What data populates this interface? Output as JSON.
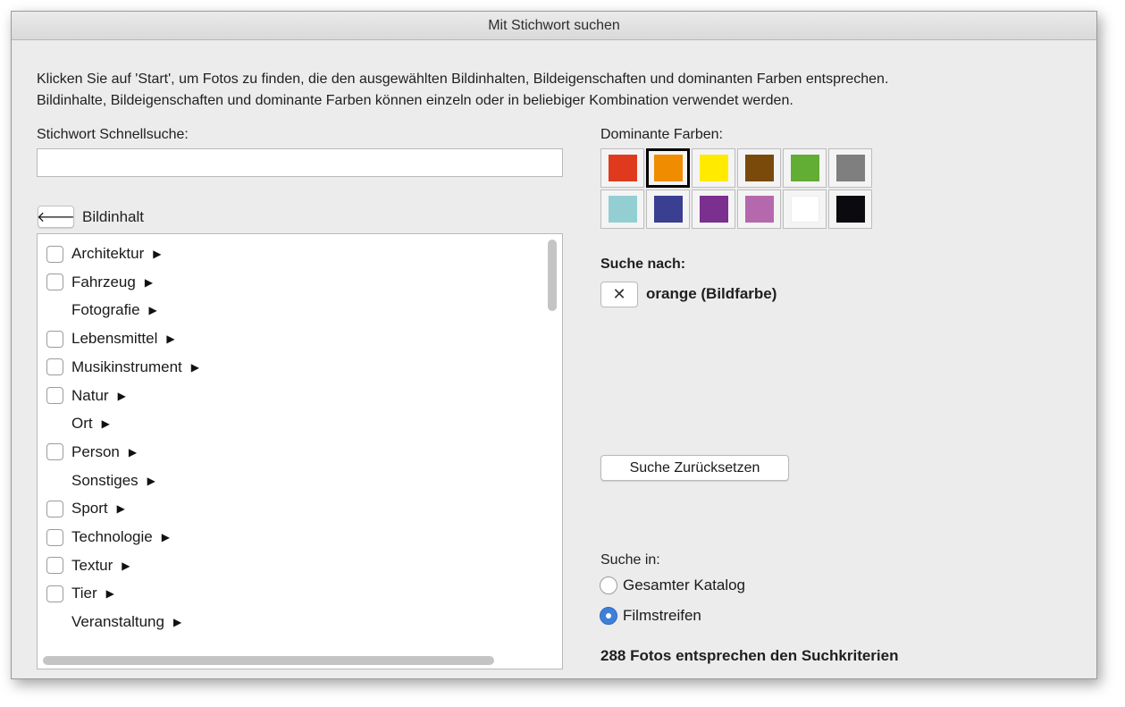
{
  "window": {
    "title": "Mit Stichwort suchen"
  },
  "intro": {
    "line1": "Klicken Sie auf 'Start', um Fotos zu finden, die den ausgewählten Bildinhalten, Bildeigenschaften und dominanten Farben entsprechen.",
    "line2": "Bildinhalte, Bildeigenschaften und dominante Farben können einzeln oder in beliebiger Kombination verwendet werden."
  },
  "quick_search": {
    "label": "Stichwort Schnellsuche:",
    "value": "",
    "placeholder": ""
  },
  "content_list": {
    "back_icon": "arrow-left-icon",
    "back_glyph": "🡐",
    "heading": "Bildinhalt",
    "items": [
      {
        "label": "Architektur",
        "has_checkbox": true
      },
      {
        "label": "Fahrzeug",
        "has_checkbox": true
      },
      {
        "label": "Fotografie",
        "has_checkbox": false
      },
      {
        "label": "Lebensmittel",
        "has_checkbox": true
      },
      {
        "label": "Musikinstrument",
        "has_checkbox": true
      },
      {
        "label": "Natur",
        "has_checkbox": true
      },
      {
        "label": "Ort",
        "has_checkbox": false
      },
      {
        "label": "Person",
        "has_checkbox": true
      },
      {
        "label": "Sonstiges",
        "has_checkbox": false
      },
      {
        "label": "Sport",
        "has_checkbox": true
      },
      {
        "label": "Technologie",
        "has_checkbox": true
      },
      {
        "label": "Textur",
        "has_checkbox": true
      },
      {
        "label": "Tier",
        "has_checkbox": true
      },
      {
        "label": "Veranstaltung",
        "has_checkbox": false
      }
    ],
    "expand_glyph": "▶"
  },
  "dominant_colors": {
    "label": "Dominante Farben:",
    "selected_index": 1,
    "swatches": [
      "#e03a1e",
      "#f08c00",
      "#ffea00",
      "#7a4a0a",
      "#62ad34",
      "#7f7f7f",
      "#93cfd2",
      "#3a3f91",
      "#7b2f8e",
      "#b569ad",
      "#ffffff",
      "#0a0a0f"
    ]
  },
  "search_for": {
    "label": "Suche nach:",
    "remove_glyph": "✕",
    "criterion": "orange (Bildfarbe)"
  },
  "reset_button": {
    "label": "Suche Zurücksetzen"
  },
  "search_in": {
    "label": "Suche in:",
    "options": [
      {
        "label": "Gesamter Katalog",
        "checked": false
      },
      {
        "label": "Filmstreifen",
        "checked": true
      }
    ]
  },
  "result": {
    "text": "288 Fotos entsprechen den Suchkriterien"
  }
}
